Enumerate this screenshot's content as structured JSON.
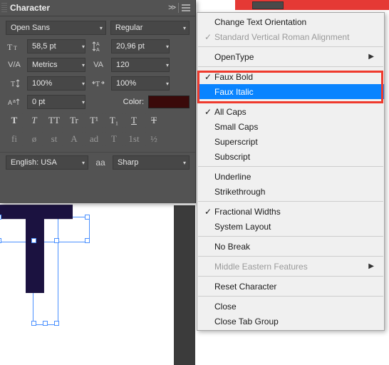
{
  "panel": {
    "title": "Character",
    "font_family": "Open Sans",
    "font_style": "Regular",
    "size": "58,5 pt",
    "leading": "20,96 pt",
    "kerning": "Metrics",
    "tracking": "120",
    "vscale": "100%",
    "hscale": "100%",
    "baseline": "0 pt",
    "color_label": "Color:",
    "color_hex": "#3a0a0a",
    "language": "English: USA",
    "aa_icon": "aa",
    "aa_mode": "Sharp",
    "style_buttons_row1": [
      "T",
      "T",
      "TT",
      "Tr",
      "T¹",
      "T₁",
      "T",
      "Ŧ"
    ],
    "style_buttons_row2": [
      "fi",
      "ø",
      "st",
      "A",
      "ad",
      "T",
      "1st",
      "½"
    ]
  },
  "menu": {
    "items": [
      {
        "label": "Change Text Orientation",
        "checked": false
      },
      {
        "label": "Standard Vertical Roman Alignment",
        "checked": true,
        "disabled": true
      },
      {
        "sep": true
      },
      {
        "label": "OpenType",
        "submenu": true
      },
      {
        "sep": true
      },
      {
        "label": "Faux Bold",
        "checked": true,
        "boxed": true
      },
      {
        "label": "Faux Italic",
        "highlight": true,
        "boxed": true
      },
      {
        "sep": true
      },
      {
        "label": "All Caps",
        "checked": true
      },
      {
        "label": "Small Caps"
      },
      {
        "label": "Superscript"
      },
      {
        "label": "Subscript"
      },
      {
        "sep": true
      },
      {
        "label": "Underline"
      },
      {
        "label": "Strikethrough"
      },
      {
        "sep": true
      },
      {
        "label": "Fractional Widths",
        "checked": true
      },
      {
        "label": "System Layout"
      },
      {
        "sep": true
      },
      {
        "label": "No Break"
      },
      {
        "sep": true
      },
      {
        "label": "Middle Eastern Features",
        "submenu": true,
        "disabled": true
      },
      {
        "sep": true
      },
      {
        "label": "Reset Character"
      },
      {
        "sep": true
      },
      {
        "label": "Close"
      },
      {
        "label": "Close Tab Group"
      }
    ]
  }
}
